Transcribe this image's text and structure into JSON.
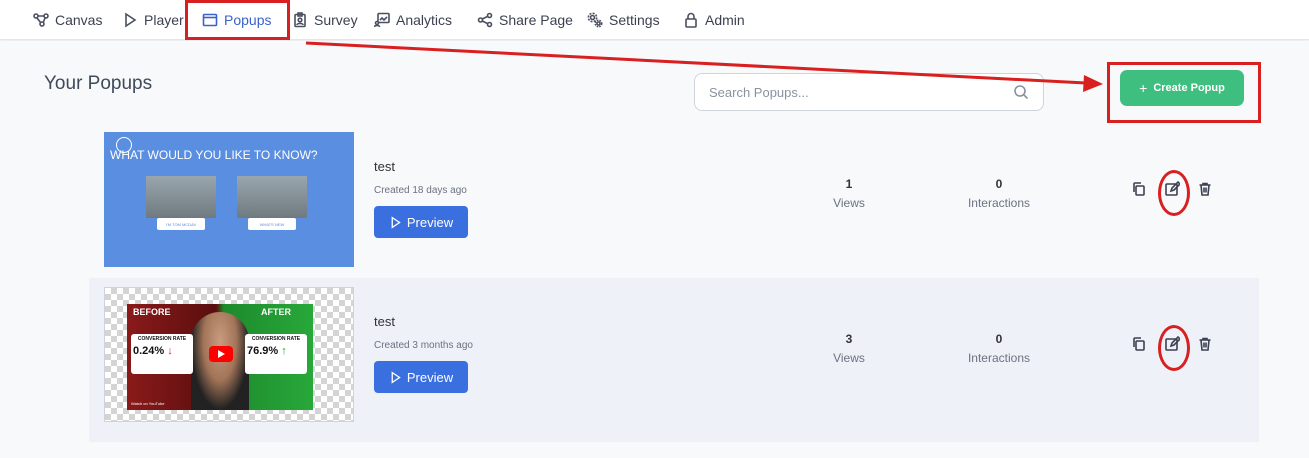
{
  "nav": {
    "items": [
      {
        "label": "Canvas",
        "icon": "share-nodes-icon"
      },
      {
        "label": "Player",
        "icon": "play-icon"
      },
      {
        "label": "Popups",
        "icon": "window-icon",
        "active": true
      },
      {
        "label": "Survey",
        "icon": "clipboard-user-icon"
      },
      {
        "label": "Analytics",
        "icon": "chart-user-icon"
      },
      {
        "label": "Share Page",
        "icon": "share-icon"
      },
      {
        "label": "Settings",
        "icon": "gears-icon"
      },
      {
        "label": "Admin",
        "icon": "lock-icon"
      }
    ]
  },
  "page": {
    "title": "Your Popups",
    "search_placeholder": "Search Popups...",
    "create_label": "Create Popup"
  },
  "popups": [
    {
      "name": "test",
      "created": "Created 18 days ago",
      "preview_label": "Preview",
      "views": "1",
      "views_label": "Views",
      "interactions": "0",
      "interactions_label": "Interactions",
      "thumbnail": {
        "question": "WHAT WOULD YOU LIKE TO KNOW?",
        "button1": "I'M TOM MCDAV",
        "button2": "WHATS NEW"
      }
    },
    {
      "name": "test",
      "created": "Created 3 months ago",
      "preview_label": "Preview",
      "views": "3",
      "views_label": "Views",
      "interactions": "0",
      "interactions_label": "Interactions",
      "thumbnail": {
        "before": "BEFORE",
        "after": "AFTER",
        "left_card_title": "CONVERSION RATE",
        "left_card_value": "0.24%",
        "right_card_title": "CONVERSION RATE",
        "right_card_value": "76.9%",
        "watch": "Watch on YouTube"
      }
    }
  ],
  "colors": {
    "accent": "#3a63c9",
    "create": "#3fbf7f",
    "preview": "#3a6fe0",
    "highlight": "#d92020"
  }
}
